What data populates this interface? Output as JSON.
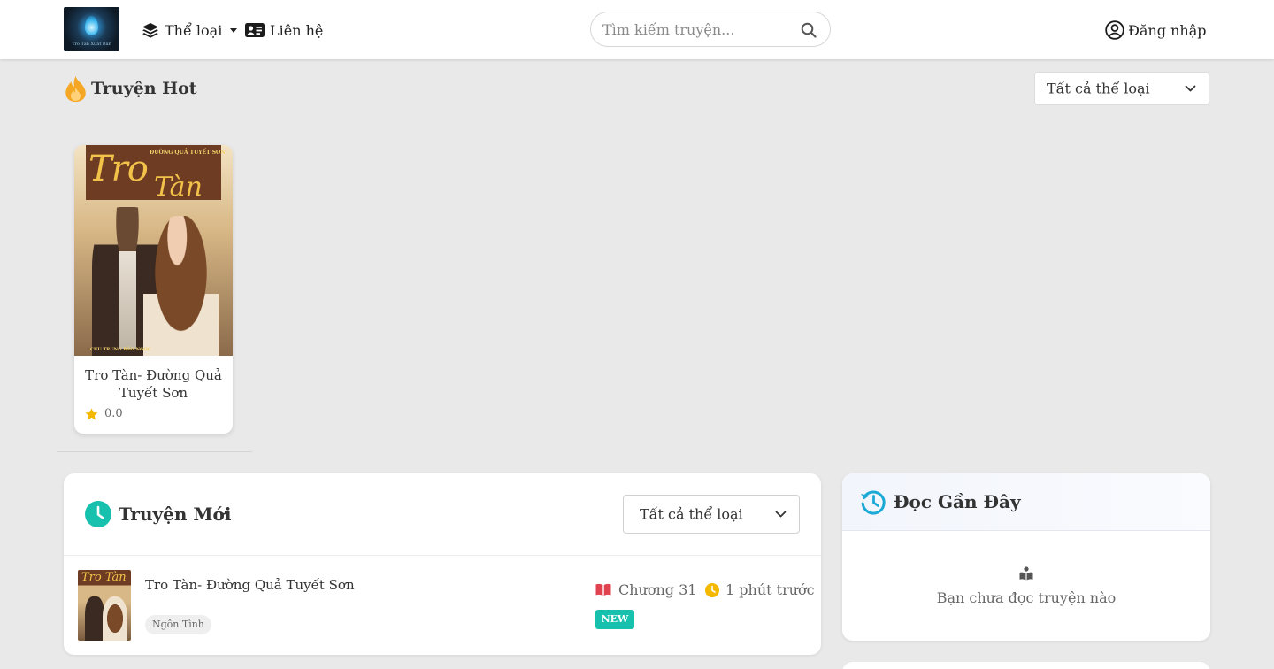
{
  "header": {
    "genre_label": "Thể loại",
    "contact_label": "Liên hệ",
    "search_placeholder": "Tìm kiếm truyện...",
    "login_label": "Đăng nhập",
    "logo_text": "Tro Tàn Xuất Bản"
  },
  "hot": {
    "title": "Truyện Hot",
    "filter_value": "Tất cả thể loại",
    "items": [
      {
        "name": "Tro Tàn- Đường Quả Tuyết Sơn",
        "rating": "0.0",
        "cover_title_1": "Tro",
        "cover_title_2": "Tàn",
        "cover_author_top": "ĐƯỜNG QUẢ TUYẾT SƠN",
        "cover_author_bottom": "CUU TRUNG BẢO NGỌC"
      }
    ]
  },
  "new_stories": {
    "title": "Truyện Mới",
    "filter_value": "Tất cả thể loại",
    "items": [
      {
        "name": "Tro Tàn- Đường Quả Tuyết Sơn",
        "genre": "Ngôn Tình",
        "chapter": "Chương 31",
        "time": "1 phút trước",
        "badge": "NEW",
        "thumb_title": "Tro Tàn"
      }
    ]
  },
  "recent": {
    "title": "Đọc Gần Đây",
    "empty_text": "Bạn chưa đọc truyện nào"
  },
  "colors": {
    "accent_teal": "#17c1ad",
    "hot_orange": "#f5a623",
    "recent_blue": "#1ba9d6",
    "chapter_red": "#e0434f",
    "time_yellow": "#f5b800"
  }
}
